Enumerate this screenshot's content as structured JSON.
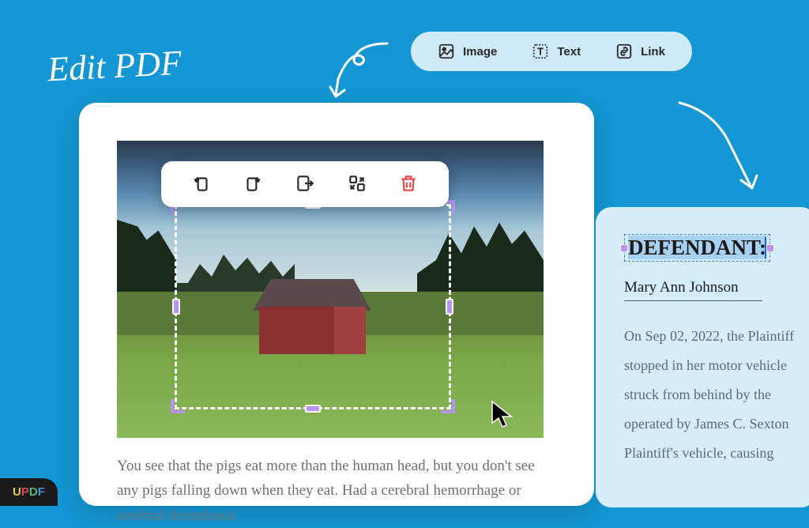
{
  "title": "Edit PDF",
  "toolbar": {
    "image": "Image",
    "text": "Text",
    "link": "Link"
  },
  "doc_text": "You see that the pigs eat more than the human head, but you don't see any pigs falling down when they eat. Had a cerebral hemorrhage or cerebral thrombosis",
  "panel": {
    "defendant_label": "DEFENDANT:",
    "name": "Mary Ann Johnson",
    "body": "On Sep 02, 2022, the Plaintiff stopped in her motor vehicle struck from behind by the operated by James C. Sexton Plaintiff's vehicle, causing"
  },
  "logo": {
    "u": "U",
    "p": "P",
    "d": "D",
    "f": "F"
  }
}
